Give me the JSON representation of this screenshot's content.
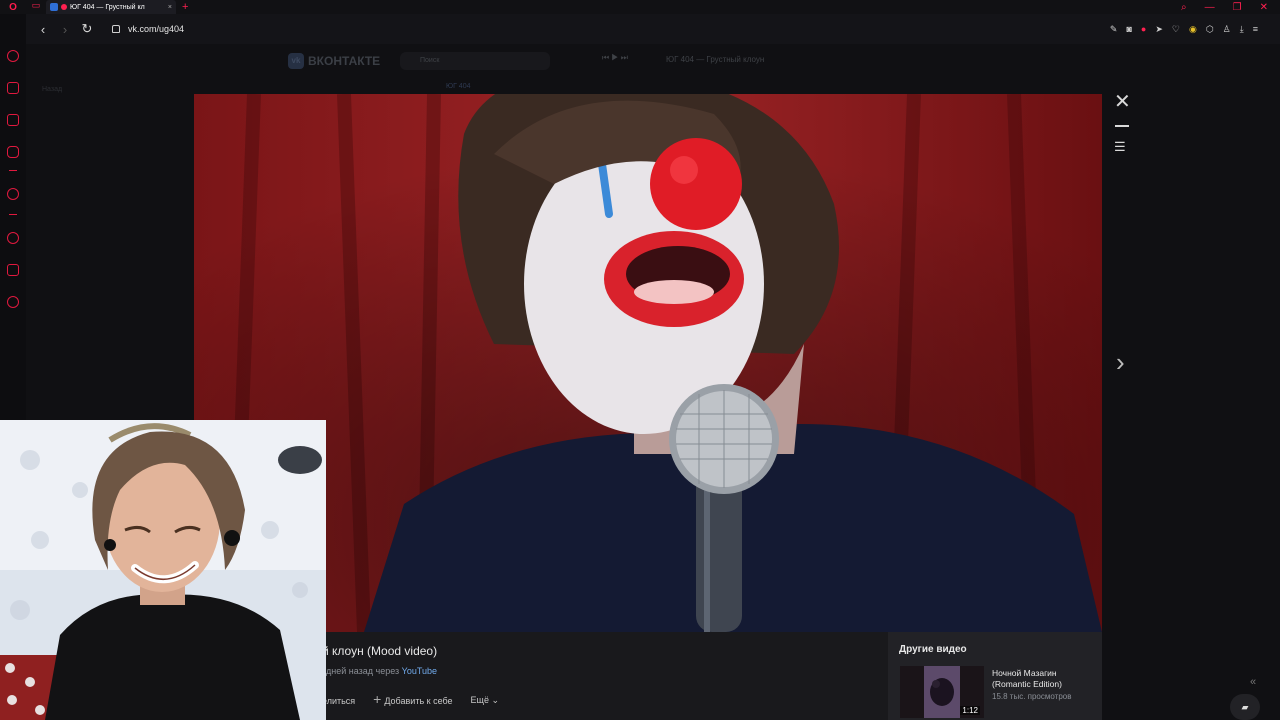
{
  "browser": {
    "tab_title": "ЮГ 404 — Грустный кл",
    "url": "vk.com/ug404",
    "accent": "#ff1b4d"
  },
  "vk": {
    "logo": "ВКОНТАКТЕ",
    "search_placeholder": "Поиск",
    "now_playing": "ЮГ 404 — Грустный клоун",
    "back_link": "Назад",
    "community_name": "ЮГ 404"
  },
  "video": {
    "title": "й клоун (Mood video)",
    "meta_prefix": "дней назад через",
    "meta_source": "YouTube",
    "share": "елиться",
    "add": "Добавить к себе",
    "more": "Ещё"
  },
  "other_videos": {
    "heading": "Другие видео",
    "items": [
      {
        "title": "Ночной Мазагин (Romantic Edition)",
        "views": "15.8 тыс. просмотров",
        "duration": "1:12"
      }
    ]
  },
  "icons": {
    "close": "close-icon",
    "minimize": "minimize-icon",
    "playlist": "playlist-icon",
    "next": "chevron-right-icon",
    "chat": "chat-icon",
    "collapse": "collapse-icon"
  }
}
